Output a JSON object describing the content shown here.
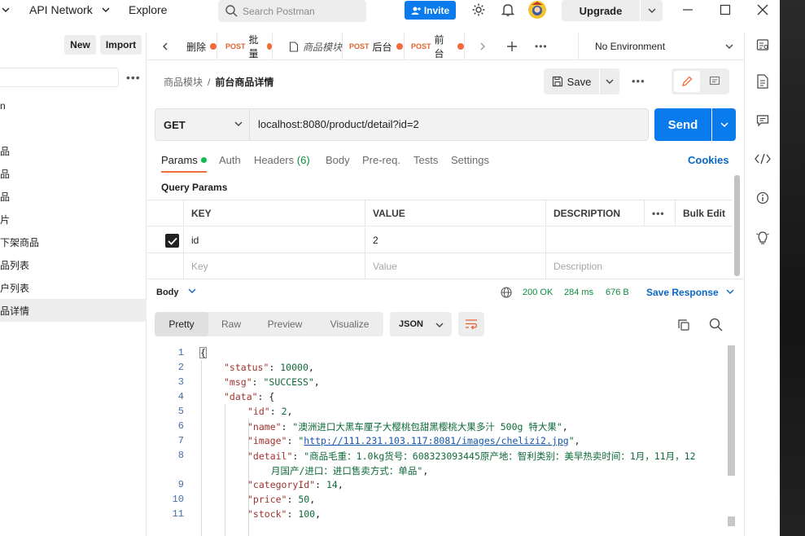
{
  "topbar": {
    "workspace": "API Network",
    "explore": "Explore",
    "search_placeholder": "Search Postman",
    "invite": "Invite",
    "upgrade": "Upgrade"
  },
  "sidebar": {
    "new_label": "New",
    "import_label": "Import",
    "items": [
      "n",
      "品",
      "品",
      "品",
      "片",
      "下架商品",
      "品列表",
      "户列表",
      "品详情"
    ]
  },
  "tabs": [
    {
      "method": "",
      "label": "删除"
    },
    {
      "method": "POST",
      "label": "批量"
    },
    {
      "method": "",
      "label": "商品模块"
    },
    {
      "method": "POST",
      "label": "后台"
    },
    {
      "method": "POST",
      "label": "前台"
    }
  ],
  "environment": "No Environment",
  "breadcrumb": {
    "parent": "商品模块",
    "current": "前台商品详情"
  },
  "save_label": "Save",
  "request": {
    "method": "GET",
    "url": "localhost:8080/product/detail?id=2",
    "send_label": "Send"
  },
  "request_tabs": {
    "params": "Params",
    "auth": "Auth",
    "headers": "Headers",
    "headers_count": "(6)",
    "body": "Body",
    "prereq": "Pre-req.",
    "tests": "Tests",
    "settings": "Settings",
    "cookies": "Cookies"
  },
  "query_params": {
    "title": "Query Params",
    "headers": {
      "key": "KEY",
      "value": "VALUE",
      "description": "DESCRIPTION",
      "bulk_edit": "Bulk Edit"
    },
    "rows": [
      {
        "key": "id",
        "value": "2",
        "description": ""
      }
    ],
    "placeholders": {
      "key": "Key",
      "value": "Value",
      "description": "Description"
    }
  },
  "response": {
    "body_label": "Body",
    "status": "200 OK",
    "time": "284 ms",
    "size": "676 B",
    "save_response": "Save Response",
    "format_tabs": [
      "Pretty",
      "Raw",
      "Preview",
      "Visualize"
    ],
    "format": "JSON"
  },
  "code": {
    "line_numbers": [
      "1",
      "2",
      "3",
      "4",
      "5",
      "6",
      "7",
      "8",
      "",
      "9",
      "10",
      "11"
    ],
    "lines": [
      {
        "indent": 0,
        "key": "",
        "value": "{",
        "vtype": "p",
        "trail": ""
      },
      {
        "indent": 1,
        "key": "\"status\"",
        "value": "10000",
        "vtype": "n",
        "trail": ","
      },
      {
        "indent": 1,
        "key": "\"msg\"",
        "value": "\"SUCCESS\"",
        "vtype": "s",
        "trail": ","
      },
      {
        "indent": 1,
        "key": "\"data\"",
        "value": "{",
        "vtype": "p",
        "trail": ""
      },
      {
        "indent": 2,
        "key": "\"id\"",
        "value": "2",
        "vtype": "n",
        "trail": ","
      },
      {
        "indent": 2,
        "key": "\"name\"",
        "value": "\"澳洲进口大黑车厘子大樱桃包甜黑樱桃大果多汁 500g 特大果\"",
        "vtype": "s",
        "trail": ","
      },
      {
        "indent": 2,
        "key": "\"image\"",
        "value": "\"http://111.231.103.117:8081/images/chelizi2.jpg\"",
        "vtype": "u",
        "trail": ","
      },
      {
        "indent": 2,
        "key": "\"detail\"",
        "value": "\"商品毛重：1.0kg货号：608323093445原产地：智利类别：美早热卖时间：1月，11月，12",
        "vtype": "s",
        "trail": ""
      },
      {
        "indent": 3,
        "key": "",
        "value": "月国产/进口：进口售卖方式：单品\"",
        "vtype": "s",
        "trail": ","
      },
      {
        "indent": 2,
        "key": "\"categoryId\"",
        "value": "14",
        "vtype": "n",
        "trail": ","
      },
      {
        "indent": 2,
        "key": "\"price\"",
        "value": "50",
        "vtype": "n",
        "trail": ","
      },
      {
        "indent": 2,
        "key": "\"stock\"",
        "value": "100",
        "vtype": "n",
        "trail": ","
      }
    ]
  }
}
